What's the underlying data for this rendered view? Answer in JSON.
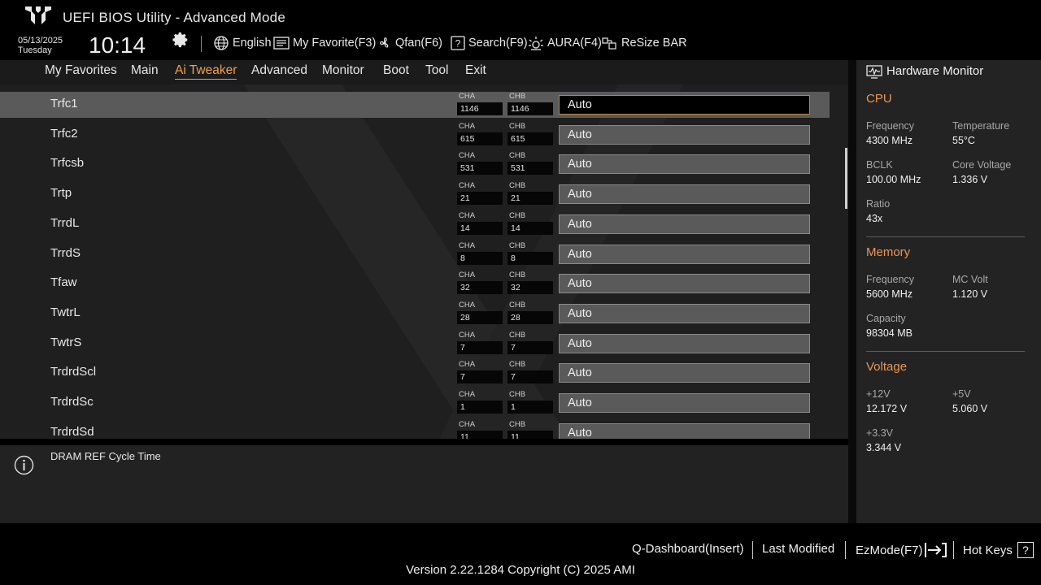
{
  "header": {
    "title": "UEFI BIOS Utility - Advanced Mode",
    "date": "05/13/2025",
    "weekday": "Tuesday",
    "time": "10:14",
    "toolbar": {
      "language": "English",
      "favorite": "My Favorite(F3)",
      "qfan": "Qfan(F6)",
      "search": "Search(F9)",
      "aura": "AURA(F4)",
      "resize_bar": "ReSize BAR"
    }
  },
  "tabs": [
    "My Favorites",
    "Main",
    "Ai Tweaker",
    "Advanced",
    "Monitor",
    "Boot",
    "Tool",
    "Exit"
  ],
  "active_tab": "Ai Tweaker",
  "channel_labels": {
    "a": "CHA",
    "b": "CHB"
  },
  "rows": [
    {
      "label": "Trfc1",
      "cha": "1146",
      "chb": "1146",
      "value": "Auto",
      "selected": true
    },
    {
      "label": "Trfc2",
      "cha": "615",
      "chb": "615",
      "value": "Auto"
    },
    {
      "label": "Trfcsb",
      "cha": "531",
      "chb": "531",
      "value": "Auto"
    },
    {
      "label": "Trtp",
      "cha": "21",
      "chb": "21",
      "value": "Auto"
    },
    {
      "label": "TrrdL",
      "cha": "14",
      "chb": "14",
      "value": "Auto"
    },
    {
      "label": "TrrdS",
      "cha": "8",
      "chb": "8",
      "value": "Auto"
    },
    {
      "label": "Tfaw",
      "cha": "32",
      "chb": "32",
      "value": "Auto"
    },
    {
      "label": "TwtrL",
      "cha": "28",
      "chb": "28",
      "value": "Auto"
    },
    {
      "label": "TwtrS",
      "cha": "7",
      "chb": "7",
      "value": "Auto"
    },
    {
      "label": "TrdrdScl",
      "cha": "7",
      "chb": "7",
      "value": "Auto"
    },
    {
      "label": "TrdrdSc",
      "cha": "1",
      "chb": "1",
      "value": "Auto"
    },
    {
      "label": "TrdrdSd",
      "cha": "11",
      "chb": "11",
      "value": "Auto"
    }
  ],
  "info": {
    "text": "DRAM REF Cycle Time"
  },
  "hardware_monitor": {
    "title": "Hardware Monitor",
    "cpu": {
      "heading": "CPU",
      "frequency_label": "Frequency",
      "frequency": "4300 MHz",
      "temperature_label": "Temperature",
      "temperature": "55°C",
      "bclk_label": "BCLK",
      "bclk": "100.00 MHz",
      "core_voltage_label": "Core Voltage",
      "core_voltage": "1.336 V",
      "ratio_label": "Ratio",
      "ratio": "43x"
    },
    "memory": {
      "heading": "Memory",
      "frequency_label": "Frequency",
      "frequency": "5600 MHz",
      "mc_volt_label": "MC Volt",
      "mc_volt": "1.120 V",
      "capacity_label": "Capacity",
      "capacity": "98304 MB"
    },
    "voltage": {
      "heading": "Voltage",
      "v12_label": "+12V",
      "v12": "12.172 V",
      "v5_label": "+5V",
      "v5": "5.060 V",
      "v33_label": "+3.3V",
      "v33": "3.344 V"
    }
  },
  "footer": {
    "q_dashboard": "Q-Dashboard(Insert)",
    "last_modified": "Last Modified",
    "ezmode": "EzMode(F7)",
    "hot_keys": "Hot Keys",
    "hot_keys_glyph": "?",
    "version": "Version 2.22.1284 Copyright (C) 2025 AMI"
  },
  "colors": {
    "accent": "#f0a050",
    "background": "#1f1f1f",
    "selected_row": "#5a5a5a"
  }
}
